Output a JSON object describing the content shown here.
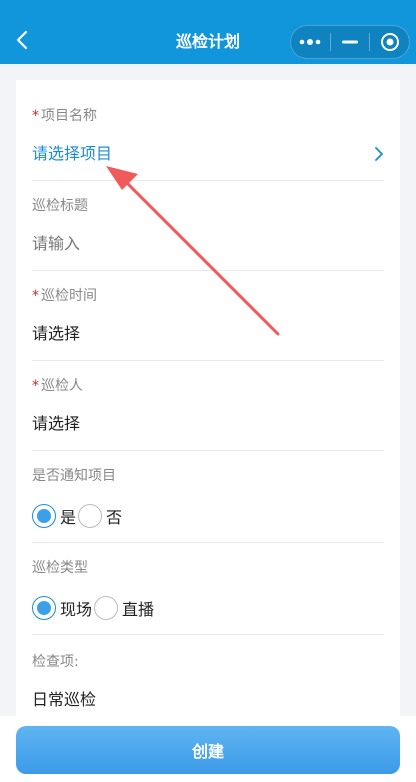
{
  "header": {
    "title": "巡检计划",
    "back_icon": "chevron-left-icon",
    "menu_icons": [
      "more-dots-icon",
      "minimize-icon",
      "close-target-icon"
    ]
  },
  "form": {
    "project": {
      "required": "*",
      "label": "项目名称",
      "value": "请选择项目"
    },
    "inspection_title": {
      "label": "巡检标题",
      "placeholder": "请输入"
    },
    "inspection_time": {
      "required": "*",
      "label": "巡检时间",
      "value": "请选择"
    },
    "inspector": {
      "required": "*",
      "label": "巡检人",
      "value": "请选择"
    },
    "notify_project": {
      "label": "是否通知项目",
      "options": [
        {
          "label": "是",
          "checked": true
        },
        {
          "label": "否",
          "checked": false
        }
      ]
    },
    "inspection_type": {
      "label": "巡检类型",
      "options": [
        {
          "label": "现场",
          "checked": true
        },
        {
          "label": "直播",
          "checked": false
        }
      ]
    },
    "check_items": {
      "label": "检查项:",
      "value": "日常巡检"
    }
  },
  "footer": {
    "create_label": "创建"
  },
  "colors": {
    "primary": "#1296db",
    "link": "#1a8cd8",
    "required": "#e02020",
    "annotation_arrow": "#f05a5a"
  }
}
